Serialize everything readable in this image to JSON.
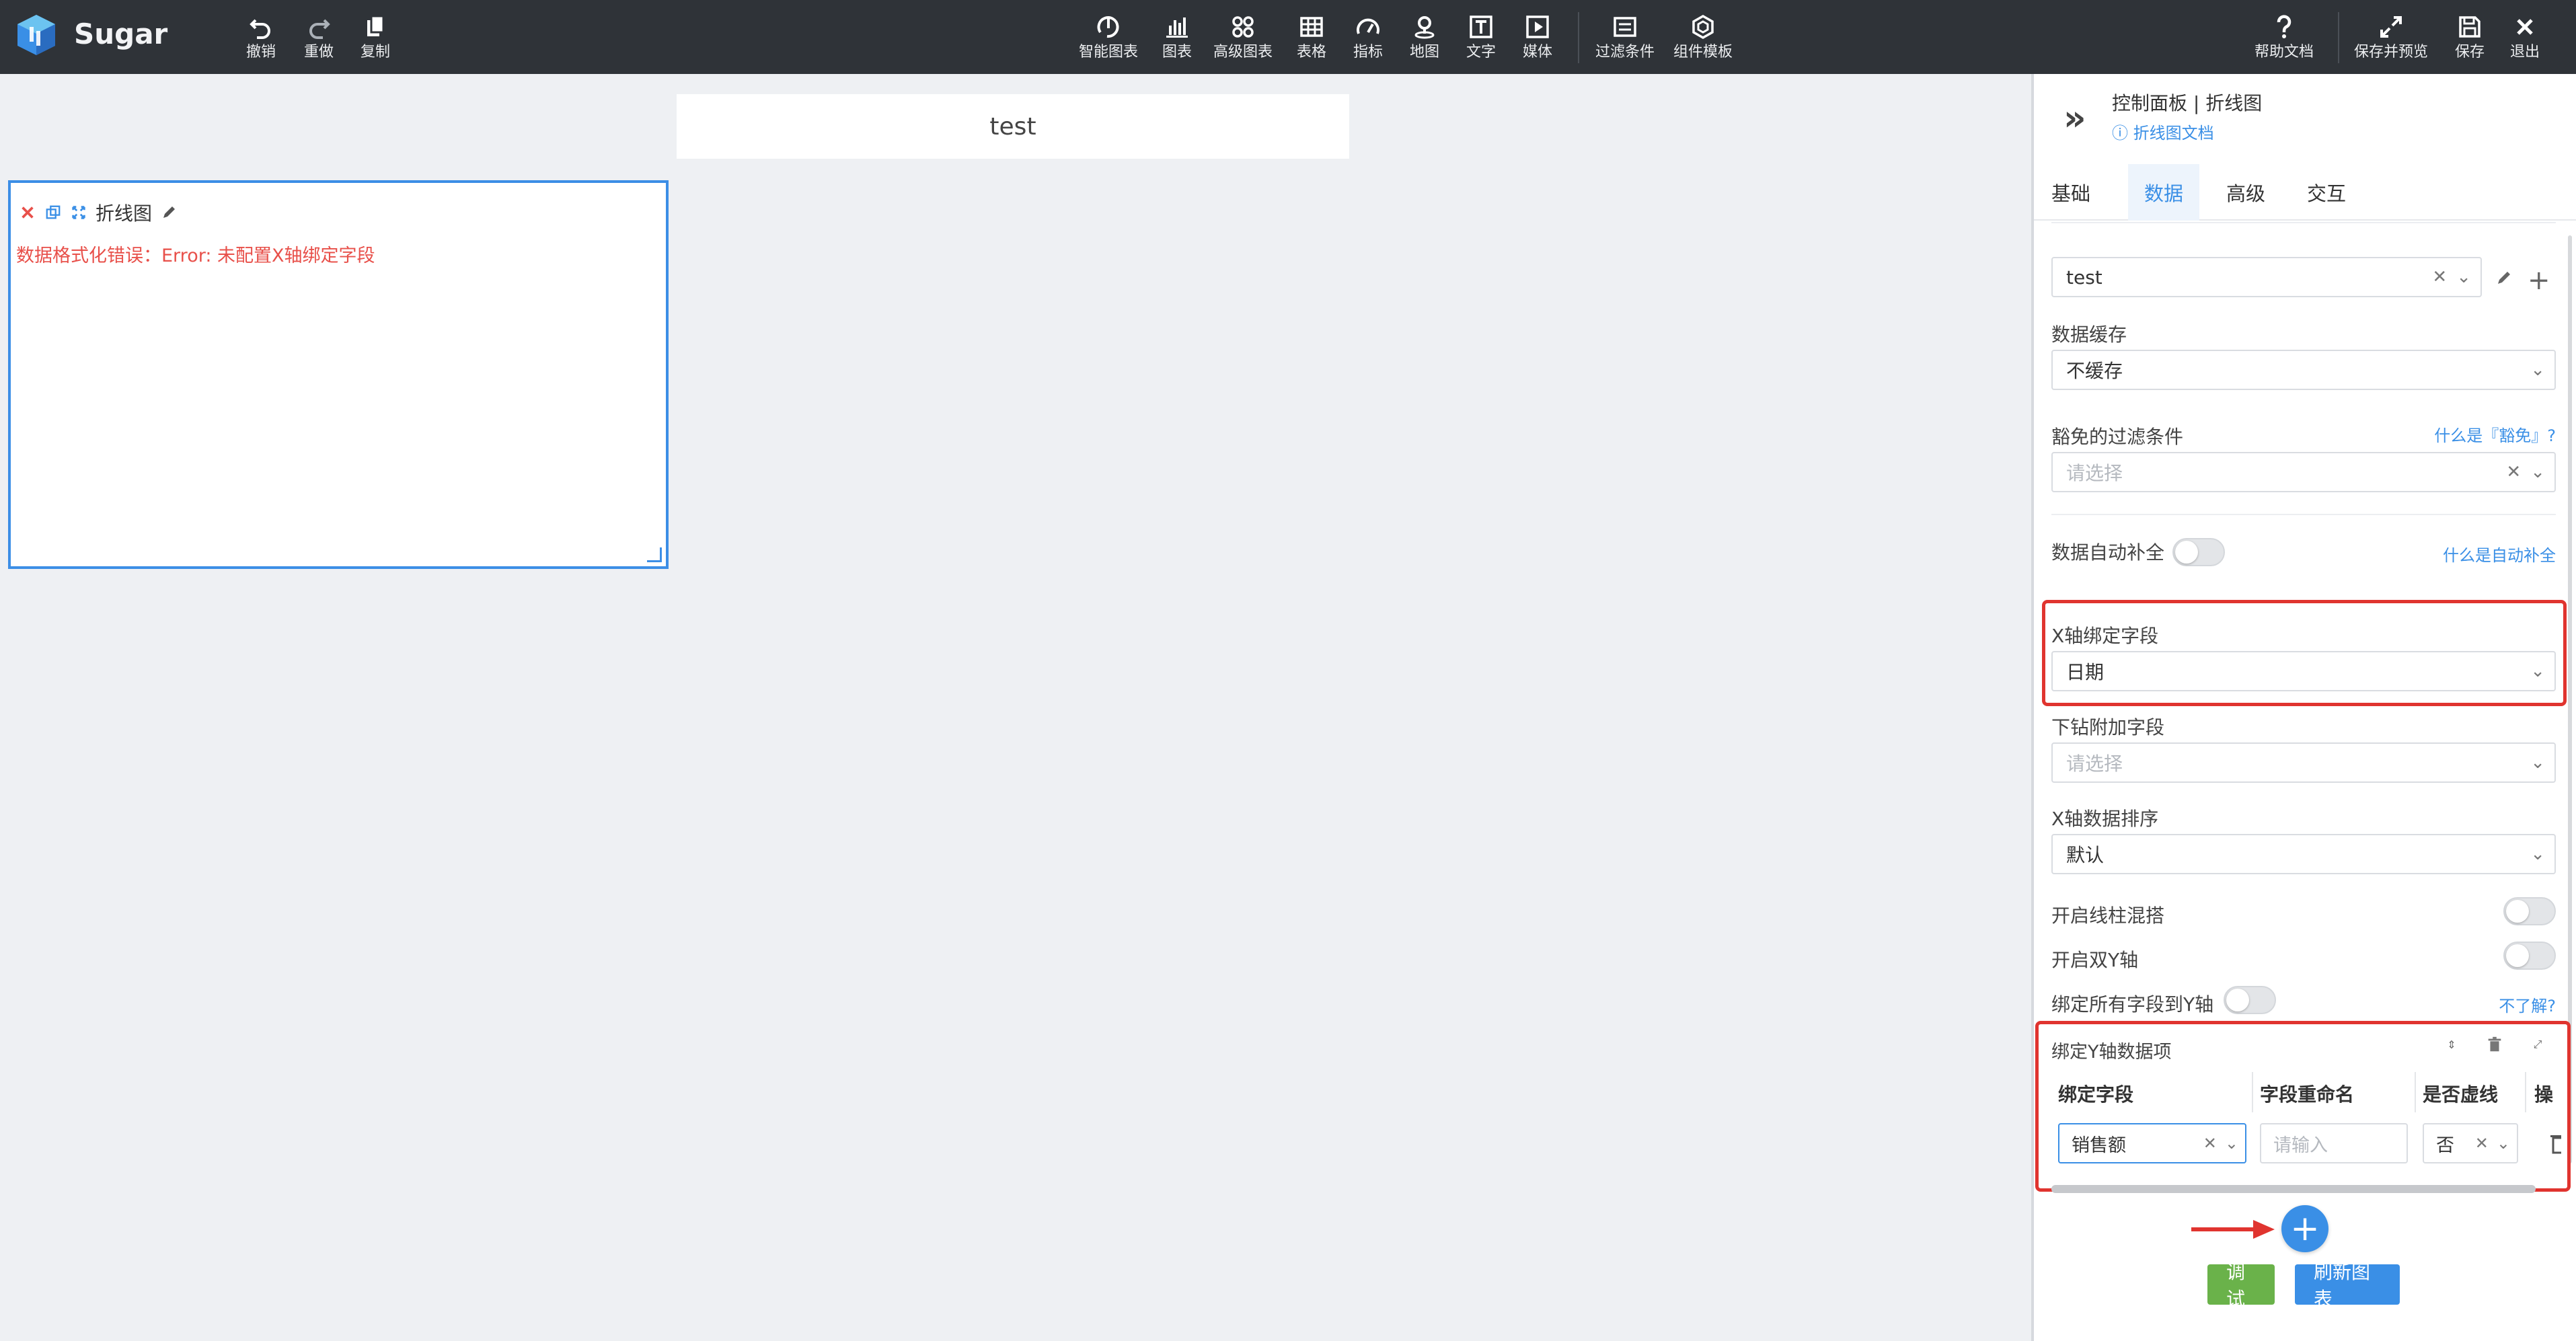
{
  "app": {
    "name": "Sugar"
  },
  "toolbar": {
    "undo": "撤销",
    "redo": "重做",
    "copy": "复制",
    "smart_chart": "智能图表",
    "chart": "图表",
    "advanced_chart": "高级图表",
    "table": "表格",
    "metric": "指标",
    "map": "地图",
    "text": "文字",
    "media": "媒体",
    "filter": "过滤条件",
    "component_template": "组件模板",
    "help_doc": "帮助文档",
    "save_preview": "保存并预览",
    "save": "保存",
    "exit": "退出"
  },
  "canvas": {
    "title_text": "test",
    "chart_card": {
      "name": "折线图",
      "error": "数据格式化错误：Error: 未配置X轴绑定字段"
    }
  },
  "panel": {
    "breadcrumb": "控制面板 | 折线图",
    "doc_link": "折线图文档",
    "tabs": [
      "基础",
      "数据",
      "高级",
      "交互"
    ],
    "active_tab": "数据",
    "source_value": "test",
    "cache_label": "数据缓存",
    "cache_value": "不缓存",
    "exempt_filter_label": "豁免的过滤条件",
    "exempt_filter_link": "什么是『豁免』?",
    "exempt_filter_placeholder": "请选择",
    "auto_fill_label": "数据自动补全",
    "auto_fill_link": "什么是自动补全",
    "x_axis_label": "X轴绑定字段",
    "x_axis_value": "日期",
    "drill_label": "下钻附加字段",
    "drill_placeholder": "请选择",
    "x_sort_label": "X轴数据排序",
    "x_sort_value": "默认",
    "mix_label": "开启线柱混搭",
    "dual_y_label": "开启双Y轴",
    "bind_all_label": "绑定所有字段到Y轴",
    "bind_all_link": "不了解?",
    "y_table": {
      "title": "绑定Y轴数据项",
      "headers": [
        "绑定字段",
        "字段重命名",
        "是否虚线",
        "操"
      ],
      "row": {
        "field": "销售额",
        "rename_placeholder": "请输入",
        "dashed": "否"
      }
    },
    "debug_button": "调试",
    "refresh_button": "刷新图表"
  },
  "colors": {
    "accent": "#3a8fe6",
    "error": "#e8504a",
    "highlight_border": "#e0342f",
    "debug_green": "#6ab24a",
    "toolbar_bg": "#2f3338"
  }
}
